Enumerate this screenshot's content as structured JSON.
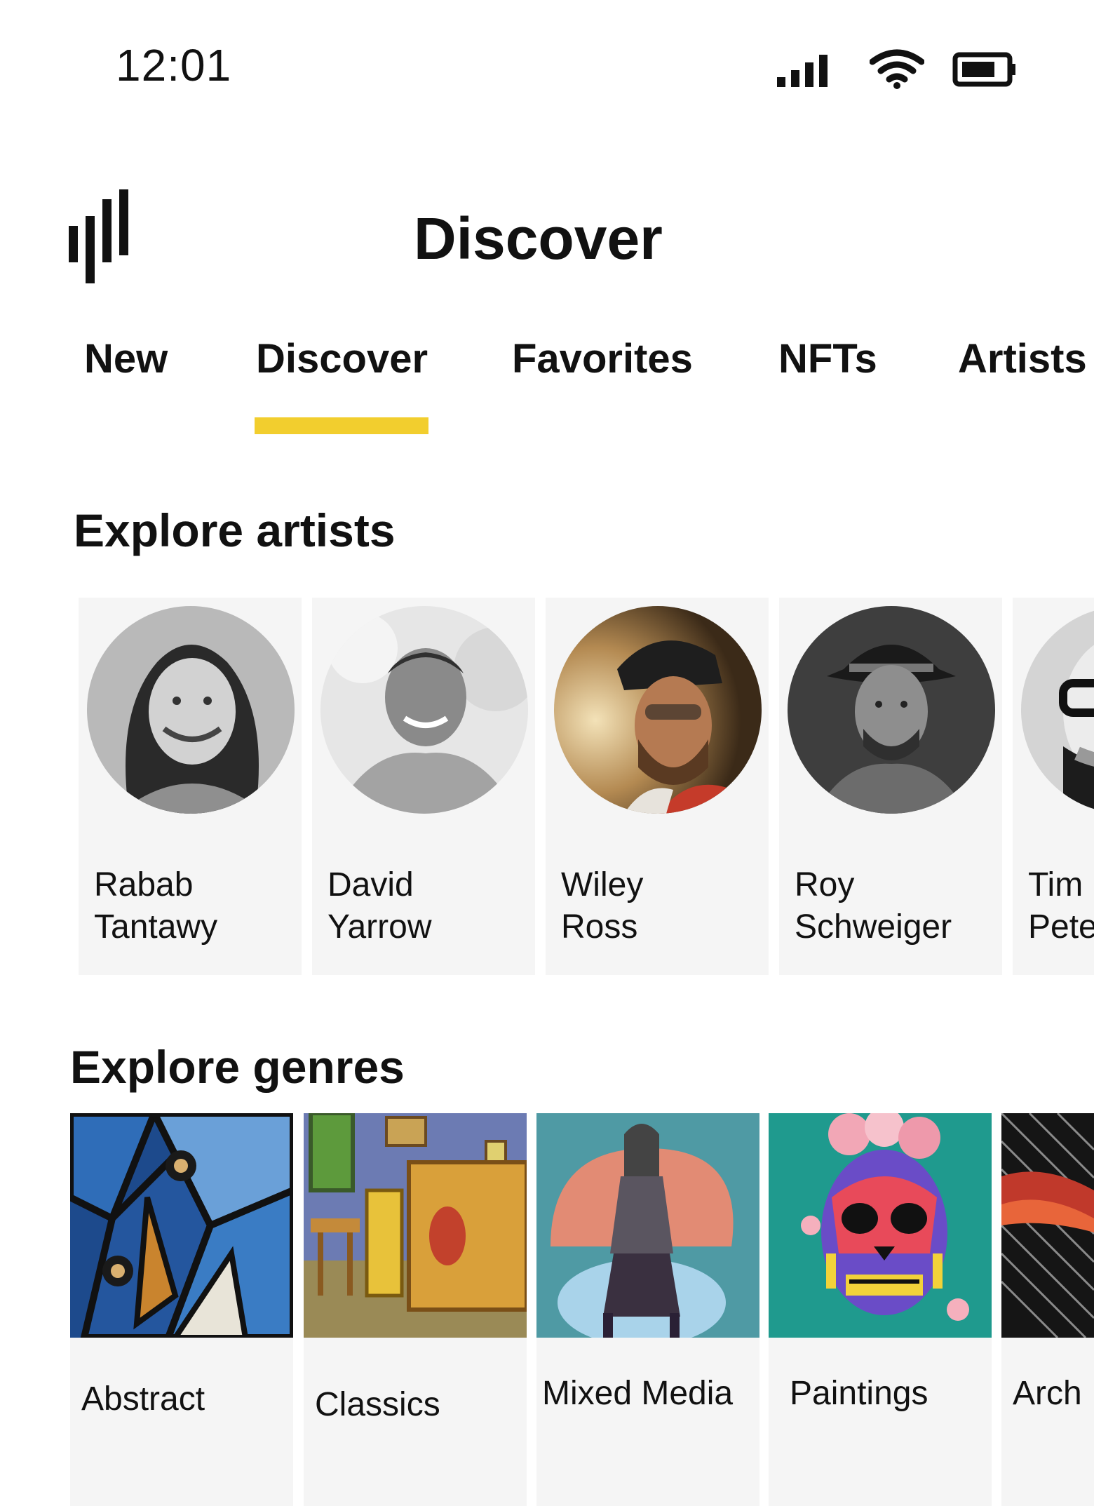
{
  "status_bar": {
    "time": "12:01",
    "icons": [
      "signal-icon",
      "wifi-icon",
      "battery-icon"
    ]
  },
  "header": {
    "logo_icon": "bars-logo-icon",
    "title": "Discover"
  },
  "tabs": [
    {
      "label": "New",
      "active": false
    },
    {
      "label": "Discover",
      "active": true
    },
    {
      "label": "Favorites",
      "active": false
    },
    {
      "label": "NFTs",
      "active": false
    },
    {
      "label": "Artists",
      "active": false
    }
  ],
  "colors": {
    "accent": "#F2CE2E",
    "card_bg": "#F5F5F5",
    "text": "#111111"
  },
  "explore_artists": {
    "title": "Explore artists",
    "artists": [
      {
        "first": "Rabab",
        "last": "Tantawy"
      },
      {
        "first": "David",
        "last": "Yarrow"
      },
      {
        "first": "Wiley",
        "last": "Ross"
      },
      {
        "first": "Roy",
        "last": "Schweiger"
      },
      {
        "first": "Tim",
        "last": "Pete"
      }
    ]
  },
  "explore_genres": {
    "title": "Explore genres",
    "genres": [
      {
        "label": "Abstract"
      },
      {
        "label": "Classics"
      },
      {
        "label": "Mixed Media"
      },
      {
        "label": "Paintings"
      },
      {
        "label": "Arch"
      }
    ]
  }
}
